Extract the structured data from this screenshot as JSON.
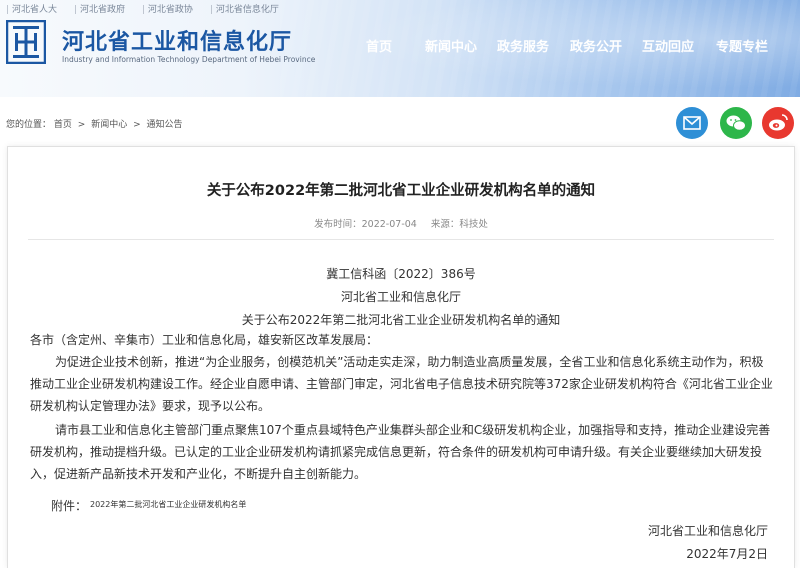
{
  "header": {
    "top_links": [
      "河北省人大",
      "河北省政府",
      "河北省政协",
      "河北省信息化厅"
    ],
    "site_title": "河北省工业和信息化厅",
    "site_subtitle": "Industry and Information Technology Department of Hebei Province",
    "nav": [
      "首页",
      "新闻中心",
      "政务服务",
      "政务公开",
      "互动回应",
      "专题专栏"
    ]
  },
  "breadcrumb": {
    "label": "您的位置：",
    "items": [
      "首页",
      "新闻中心",
      "通知公告"
    ],
    "separator": ">"
  },
  "share": {
    "icons": [
      "mail-icon",
      "wechat-icon",
      "weibo-icon"
    ]
  },
  "article": {
    "title": "关于公布2022年第二批河北省工业企业研发机构名单的通知",
    "date": "发布时间：2022-07-04",
    "source": "来源：科技处",
    "doc_number": "冀工信科函〔2022〕386号",
    "issuer": "河北省工业和信息化厅",
    "subject": "关于公布2022年第二批河北省工业企业研发机构名单的通知",
    "addressee": "各市（含定州、辛集市）工业和信息化局，雄安新区改革发展局：",
    "para1": [
      "为促进企业技术创新，推进“为企业服务，创模范机关”活动走实走深，助力制造业高质量发展，全省工业和信息化系统主动作为，积极",
      "推动工业企业研发机构建设工作。经企业自愿申请、主管部门审定，河北省电子信息技术研究院等372家企业研发机构符合《河北省工业企业",
      "研发机构认定管理办法》要求，现予以公布。"
    ],
    "para2": [
      "请市县工业和信息化主管部门重点聚焦107个重点县域特色产业集群头部企业和C级研发机构企业，加强指导和支持，推动企业建设完善",
      "研发机构，推动提档升级。已认定的工业企业研发机构请抓紧完成信息更新，符合条件的研发机构可申请升级。有关企业要继续加大研发投",
      "入，促进新产品新技术开发和产业化，不断提升自主创新能力。"
    ],
    "attachment_label": "附件：",
    "attachment_link": "2022年第二批河北省工业企业研发机构名单",
    "signature_org": "河北省工业和信息化厅",
    "signature_date": "2022年7月2日"
  },
  "colors": {
    "brand_blue": "#1b57a3",
    "mail": "#2e8fd6",
    "wechat": "#2db64a",
    "weibo": "#e8382f"
  }
}
